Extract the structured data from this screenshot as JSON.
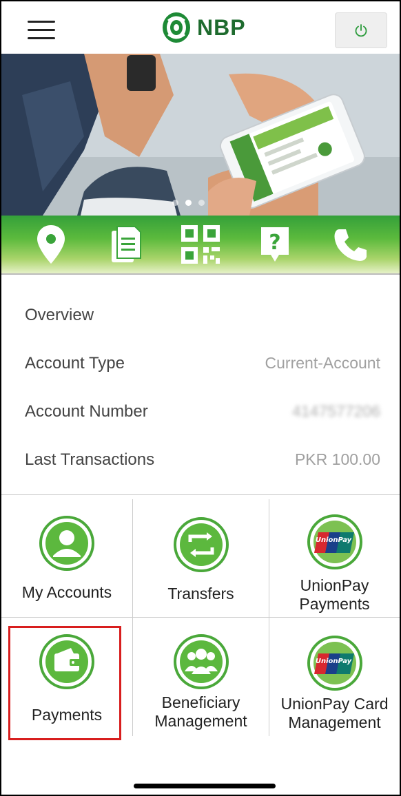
{
  "header": {
    "logo_text": "NBP",
    "menu_icon": "hamburger-icon",
    "power_icon": "power-icon"
  },
  "banner": {
    "carousel_dots": 3,
    "active_dot": 2
  },
  "toolbar": {
    "icons": [
      "location-pin-icon",
      "document-icon",
      "qr-code-icon",
      "help-icon",
      "phone-icon"
    ]
  },
  "overview": {
    "title": "Overview",
    "rows": [
      {
        "label": "Account Type",
        "value": "Current-Account"
      },
      {
        "label": "Account Number",
        "value": "4147577206"
      },
      {
        "label": "Last Transactions",
        "value": "PKR 100.00"
      }
    ]
  },
  "grid": {
    "items": [
      {
        "label": "My Accounts",
        "icon": "user-icon"
      },
      {
        "label": "Transfers",
        "icon": "transfer-arrows-icon"
      },
      {
        "label": "UnionPay\nPayments",
        "icon": "unionpay-icon"
      },
      {
        "label": "Payments",
        "icon": "wallet-icon",
        "highlighted": true
      },
      {
        "label": "Beneficiary\nManagement",
        "icon": "group-icon"
      },
      {
        "label": "UnionPay Card\nManagement",
        "icon": "unionpay-icon"
      }
    ]
  },
  "colors": {
    "brand_green": "#1e6b2e",
    "toolbar_green": "#34a03a",
    "highlight_red": "#d81e1e"
  }
}
